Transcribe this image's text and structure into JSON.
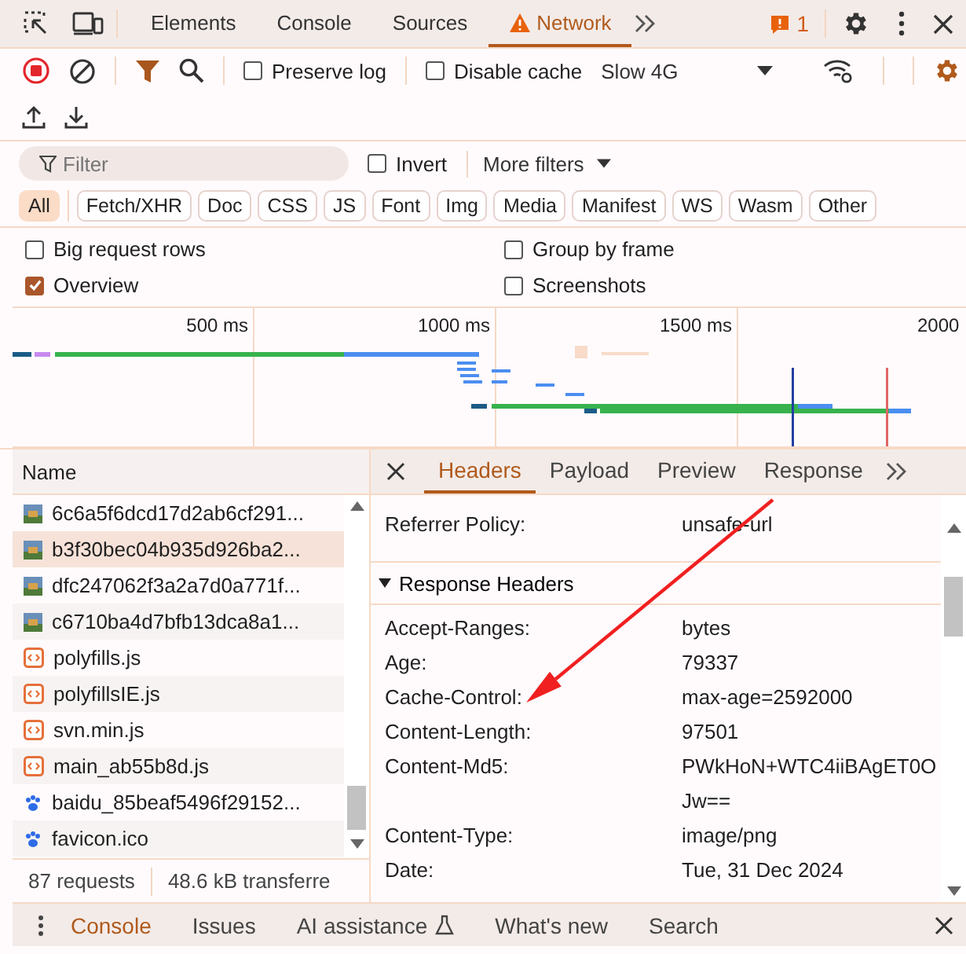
{
  "main_tabs": [
    {
      "label": "Elements",
      "selected": false,
      "kind": "plain"
    },
    {
      "label": "Console",
      "selected": false,
      "kind": "plain"
    },
    {
      "label": "Sources",
      "selected": false,
      "kind": "plain"
    },
    {
      "label": "Network",
      "selected": true,
      "kind": "warning"
    }
  ],
  "issues_count": "1",
  "toolbar": {
    "preserve_log": {
      "label": "Preserve log",
      "checked": false
    },
    "disable_cache": {
      "label": "Disable cache",
      "checked": false
    },
    "throttling": "Slow 4G"
  },
  "filter": {
    "placeholder": "Filter",
    "invert": {
      "label": "Invert",
      "checked": false
    },
    "more_filters": "More filters"
  },
  "type_filters": [
    {
      "label": "All",
      "selected": true
    },
    {
      "label": "Fetch/XHR",
      "selected": false
    },
    {
      "label": "Doc",
      "selected": false
    },
    {
      "label": "CSS",
      "selected": false
    },
    {
      "label": "JS",
      "selected": false
    },
    {
      "label": "Font",
      "selected": false
    },
    {
      "label": "Img",
      "selected": false
    },
    {
      "label": "Media",
      "selected": false
    },
    {
      "label": "Manifest",
      "selected": false
    },
    {
      "label": "WS",
      "selected": false
    },
    {
      "label": "Wasm",
      "selected": false
    },
    {
      "label": "Other",
      "selected": false
    }
  ],
  "options": [
    {
      "label": "Big request rows",
      "checked": false
    },
    {
      "label": "Group by frame",
      "checked": false
    },
    {
      "label": "Overview",
      "checked": true
    },
    {
      "label": "Screenshots",
      "checked": false
    }
  ],
  "overview": {
    "ticks": [
      "500 ms",
      "1000 ms",
      "1500 ms",
      "2000"
    ]
  },
  "requests": {
    "column": "Name",
    "rows": [
      {
        "name": "6c6a5f6dcd17d2ab6cf291...",
        "kind": "image",
        "selected": false
      },
      {
        "name": "b3f30bec04b935d926ba2...",
        "kind": "image",
        "selected": true
      },
      {
        "name": "dfc247062f3a2a7d0a771f...",
        "kind": "image",
        "selected": false
      },
      {
        "name": "c6710ba4d7bfb13dca8a1...",
        "kind": "image",
        "selected": false
      },
      {
        "name": "polyfills.js",
        "kind": "script",
        "selected": false
      },
      {
        "name": "polyfillsIE.js",
        "kind": "script",
        "selected": false
      },
      {
        "name": "svn.min.js",
        "kind": "script",
        "selected": false
      },
      {
        "name": "main_ab55b8d.js",
        "kind": "script",
        "selected": false
      },
      {
        "name": "baidu_85beaf5496f29152...",
        "kind": "favicon",
        "selected": false
      },
      {
        "name": "favicon.ico",
        "kind": "favicon",
        "selected": false
      }
    ]
  },
  "summary": [
    "87 requests",
    "48.6 kB transferre"
  ],
  "details": {
    "tabs": [
      {
        "label": "Headers",
        "selected": true
      },
      {
        "label": "Payload",
        "selected": false
      },
      {
        "label": "Preview",
        "selected": false
      },
      {
        "label": "Response",
        "selected": false
      }
    ],
    "general_rows": [
      {
        "name": "Referrer Policy:",
        "value": "unsafe-url"
      }
    ],
    "section": {
      "title": "Response Headers",
      "expanded": true,
      "rows": [
        {
          "name": "Accept-Ranges:",
          "value": "bytes"
        },
        {
          "name": "Age:",
          "value": "79337"
        },
        {
          "name": "Cache-Control:",
          "value": "max-age=2592000"
        },
        {
          "name": "Content-Length:",
          "value": "97501"
        },
        {
          "name": "Content-Md5:",
          "value": "PWkHoN+WTC4iiBAgET0OJw=="
        },
        {
          "name": "Content-Type:",
          "value": "image/png"
        },
        {
          "name": "Date:",
          "value": "Tue, 31 Dec 2024"
        }
      ]
    }
  },
  "drawer_tabs": [
    {
      "label": "Console",
      "selected": true,
      "kind": "plain"
    },
    {
      "label": "Issues",
      "selected": false,
      "kind": "plain"
    },
    {
      "label": "AI assistance",
      "selected": false,
      "kind": "experiment"
    },
    {
      "label": "What's new",
      "selected": false,
      "kind": "plain"
    },
    {
      "label": "Search",
      "selected": false,
      "kind": "plain"
    }
  ]
}
